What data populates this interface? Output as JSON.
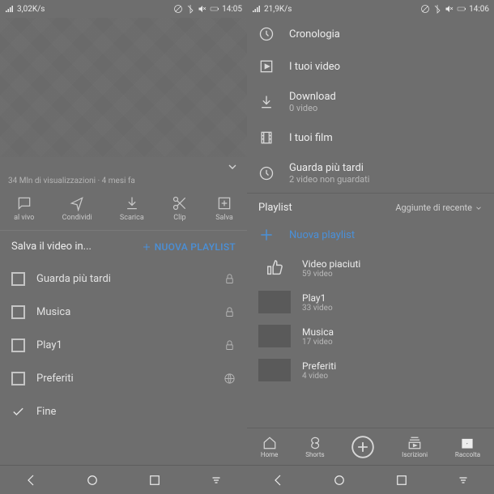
{
  "left": {
    "status": {
      "speed": "3,02K/s",
      "time": "14:05"
    },
    "video_stats": "34 Mln di visualizzazioni · 4 mesi fa",
    "actions": {
      "live": "al vivo",
      "share": "Condividi",
      "download": "Scarica",
      "clip": "Clip",
      "save": "Salva"
    },
    "sheet_title": "Salva il video in...",
    "new_playlist": "NUOVA PLAYLIST",
    "items": [
      {
        "label": "Guarda più tardi",
        "lock": true
      },
      {
        "label": "Musica",
        "lock": true
      },
      {
        "label": "Play1",
        "lock": true
      },
      {
        "label": "Preferiti",
        "globe": true
      }
    ],
    "done": "Fine"
  },
  "right": {
    "status": {
      "speed": "21,9K/s",
      "time": "14:06"
    },
    "library": {
      "history": "Cronologia",
      "your_videos": "I tuoi video",
      "downloads": {
        "label": "Download",
        "sub": "0 video"
      },
      "movies": "I tuoi film",
      "later": {
        "label": "Guarda più tardi",
        "sub": "2 video non guardati"
      }
    },
    "section_title": "Playlist",
    "sort_label": "Aggiunte di recente",
    "new_playlist": "Nuova playlist",
    "playlists": [
      {
        "name": "Video piaciuti",
        "count": "59 video",
        "liked": true
      },
      {
        "name": "Play1",
        "count": "33 video"
      },
      {
        "name": "Musica",
        "count": "17 video"
      },
      {
        "name": "Preferiti",
        "count": "4 video"
      }
    ],
    "nav": {
      "home": "Home",
      "shorts": "Shorts",
      "subs": "Iscrizioni",
      "library": "Raccolta"
    }
  }
}
